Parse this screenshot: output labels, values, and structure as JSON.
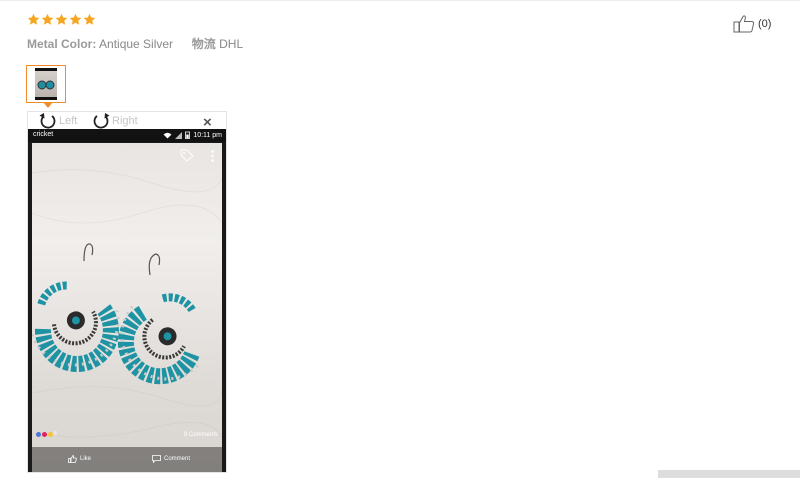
{
  "review": {
    "rating": 5,
    "star_color": "#f5a623",
    "attributes": [
      {
        "key": "Metal Color:",
        "value": "Antique Silver"
      },
      {
        "key": "物流",
        "value": "DHL"
      }
    ],
    "helpful": {
      "icon": "thumbs-up-icon",
      "count": "(0)"
    },
    "photos": [
      {
        "icon": "photo-thumbnail"
      }
    ]
  },
  "viewer": {
    "rotate_left": "Left",
    "rotate_right": "Right",
    "close": "×",
    "phone": {
      "carrier": "cricket",
      "time": "10:11 pm",
      "reactions_count": "8",
      "comments": "8 Comments",
      "like": "Like",
      "comment": "Comment"
    }
  }
}
